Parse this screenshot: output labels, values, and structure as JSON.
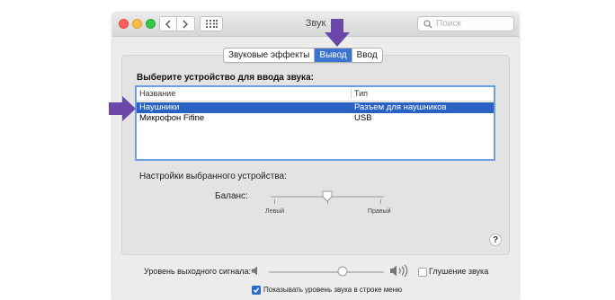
{
  "window": {
    "title": "Звук",
    "search_placeholder": "Поиск"
  },
  "tabs": [
    {
      "label": "Звуковые эффекты",
      "active": false
    },
    {
      "label": "Вывод",
      "active": true
    },
    {
      "label": "Ввод",
      "active": false
    }
  ],
  "device_section": {
    "heading": "Выберите устройство для ввода звука:",
    "columns": [
      "Название",
      "Тип"
    ],
    "rows": [
      {
        "name": "Наушники",
        "type": "Разъем для наушников",
        "selected": true
      },
      {
        "name": "Микрофон Fifine",
        "type": "USB",
        "selected": false
      }
    ]
  },
  "selected_settings": {
    "heading": "Настройки выбранного устройства:",
    "balance_label": "Баланс:",
    "left_label": "Левый",
    "right_label": "Правый",
    "balance_value": 0.5
  },
  "help": "?",
  "output": {
    "volume_label": "Уровень выходного сигнала:",
    "volume_value": 0.62,
    "mute_label": "Глушение звука",
    "mute_checked": false,
    "menu_checkbox_label": "Показывать уровень звука в строке меню",
    "menu_checked": true
  },
  "colors": {
    "accent": "#3b73d0",
    "selection": "#2962c2",
    "annotation_arrow": "#6a47a8"
  }
}
